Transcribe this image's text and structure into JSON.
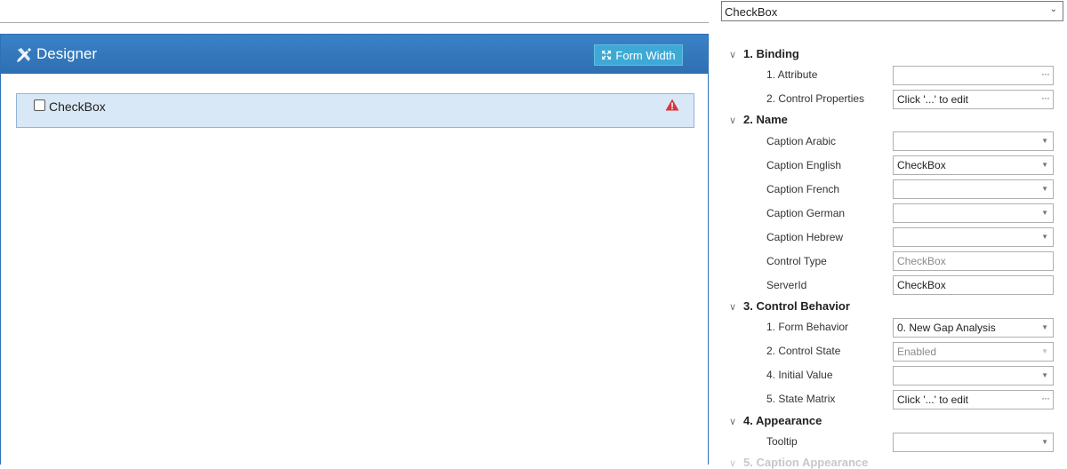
{
  "designer": {
    "title": "Designer",
    "form_width_label": "Form Width",
    "checkbox_label": "CheckBox"
  },
  "properties": {
    "selected_control": "CheckBox",
    "sections": {
      "binding": "1. Binding",
      "name": "2. Name",
      "control_behavior": "3. Control Behavior",
      "appearance": "4. Appearance",
      "caption_appearance": "5. Caption Appearance"
    },
    "binding": {
      "attribute": {
        "label": "1. Attribute",
        "value": ""
      },
      "control_properties": {
        "label": "2. Control Properties",
        "value": "Click '...' to edit"
      }
    },
    "name": {
      "caption_arabic": {
        "label": "Caption Arabic",
        "value": ""
      },
      "caption_english": {
        "label": "Caption English",
        "value": "CheckBox"
      },
      "caption_french": {
        "label": "Caption French",
        "value": ""
      },
      "caption_german": {
        "label": "Caption German",
        "value": ""
      },
      "caption_hebrew": {
        "label": "Caption Hebrew",
        "value": ""
      },
      "control_type": {
        "label": "Control Type",
        "value": "CheckBox"
      },
      "server_id": {
        "label": "ServerId",
        "value": "CheckBox"
      }
    },
    "control_behavior": {
      "form_behavior": {
        "label": "1. Form Behavior",
        "value": "0. New Gap Analysis"
      },
      "control_state": {
        "label": "2. Control State",
        "value": "Enabled"
      },
      "initial_value": {
        "label": "4. Initial Value",
        "value": ""
      },
      "state_matrix": {
        "label": "5. State Matrix",
        "value": "Click '...' to edit"
      }
    },
    "appearance": {
      "tooltip": {
        "label": "Tooltip",
        "value": ""
      }
    }
  },
  "colors": {
    "header_blue": "#2e6fb2",
    "button_cyan": "#3fa9d6",
    "selection_bg": "#d9e8f6",
    "warning_red": "#d9363e"
  },
  "icons": [
    "pencil-ruler-icon",
    "expand-arrows-icon",
    "warning-icon",
    "chevron-down-icon",
    "ellipsis-icon"
  ]
}
